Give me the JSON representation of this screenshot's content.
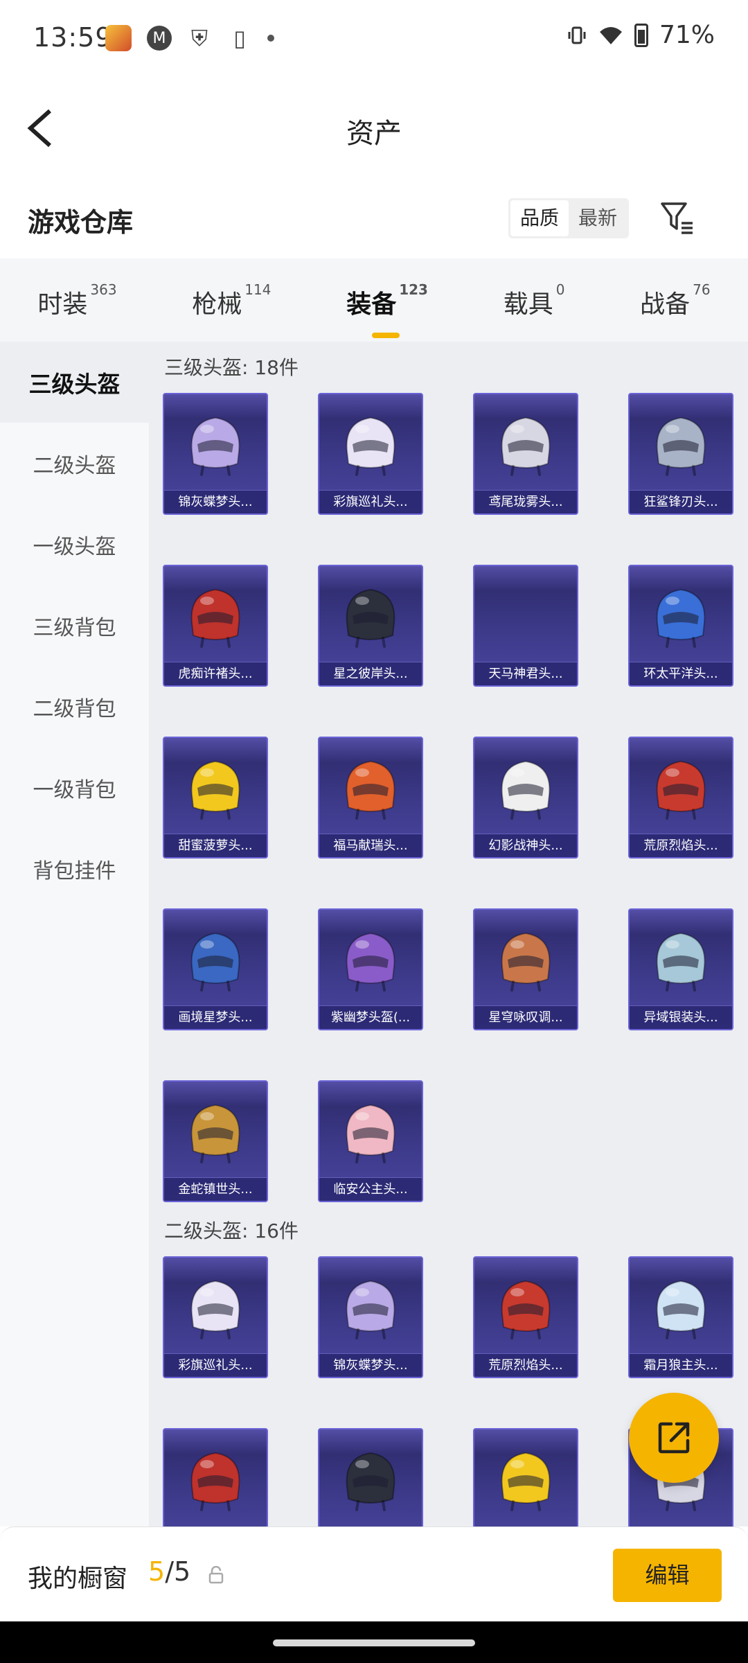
{
  "status_bar": {
    "time": "13:59",
    "battery": "71%",
    "icons": [
      "app-icon",
      "motorola-icon",
      "shield-icon",
      "phone-sync-icon",
      "dot-icon",
      "vibrate-icon",
      "wifi-icon",
      "battery-icon"
    ]
  },
  "header": {
    "title": "资产",
    "back_icon": "chevron-left-icon"
  },
  "warehouse": {
    "title": "游戏仓库",
    "sort_options": [
      "品质",
      "最新"
    ],
    "active_sort": "品质",
    "filter_icon": "filter-icon"
  },
  "tabs": [
    {
      "label": "时装",
      "count": "363"
    },
    {
      "label": "枪械",
      "count": "114"
    },
    {
      "label": "装备",
      "count": "123",
      "active": true
    },
    {
      "label": "载具",
      "count": "0"
    },
    {
      "label": "战备",
      "count": "76"
    }
  ],
  "sidebar": {
    "items": [
      "三级头盔",
      "二级头盔",
      "一级头盔",
      "三级背包",
      "二级背包",
      "一级背包",
      "背包挂件"
    ],
    "active": "三级头盔"
  },
  "groups": [
    {
      "title": "三级头盔: 18件",
      "items": [
        {
          "name": "锦灰蝶梦头...",
          "color": "#b9a9e6"
        },
        {
          "name": "彩旗巡礼头...",
          "color": "#e9e4f5"
        },
        {
          "name": "鸢尾珑雾头...",
          "color": "#d7d6e3"
        },
        {
          "name": "狂鲨锋刃头...",
          "color": "#a8b3c8"
        },
        {
          "name": "虎痴许褚头...",
          "color": "#c0322c"
        },
        {
          "name": "星之彼岸头...",
          "color": "#2c2f3c"
        },
        {
          "name": "天马神君头...",
          "color": ""
        },
        {
          "name": "环太平洋头...",
          "color": "#3a6fd8"
        },
        {
          "name": "甜蜜菠萝头...",
          "color": "#f2c81f"
        },
        {
          "name": "福马献瑞头...",
          "color": "#e2602c"
        },
        {
          "name": "幻影战神头...",
          "color": "#efefef"
        },
        {
          "name": "荒原烈焰头...",
          "color": "#c83a2e"
        },
        {
          "name": "画境星梦头...",
          "color": "#3a68c2"
        },
        {
          "name": "紫幽梦头盔(...",
          "color": "#8a5cc9"
        },
        {
          "name": "星穹咏叹调...",
          "color": "#c9774a"
        },
        {
          "name": "异域银装头...",
          "color": "#a6c8d8"
        },
        {
          "name": "金蛇镇世头...",
          "color": "#c9953a"
        },
        {
          "name": "临安公主头...",
          "color": "#f0b8c4"
        }
      ]
    },
    {
      "title": "二级头盔: 16件",
      "items": [
        {
          "name": "彩旗巡礼头...",
          "color": "#e9e4f5"
        },
        {
          "name": "锦灰蝶梦头...",
          "color": "#b9a9e6"
        },
        {
          "name": "荒原烈焰头...",
          "color": "#c83a2e"
        },
        {
          "name": "霜月狼主头...",
          "color": "#cfe3f5"
        },
        {
          "name": "",
          "color": "#c0322c"
        },
        {
          "name": "",
          "color": "#2c2f3c"
        },
        {
          "name": "",
          "color": "#f2c81f"
        },
        {
          "name": "",
          "color": "#d7d6e3"
        }
      ]
    }
  ],
  "showcase": {
    "label": "我的橱窗",
    "current": "5",
    "total": "/5",
    "edit_label": "编辑"
  },
  "fab_icon": "share-external-icon",
  "colors": {
    "accent": "#f5b400",
    "card_bg": "#3d3a8a",
    "card_border": "#6b63d6"
  }
}
